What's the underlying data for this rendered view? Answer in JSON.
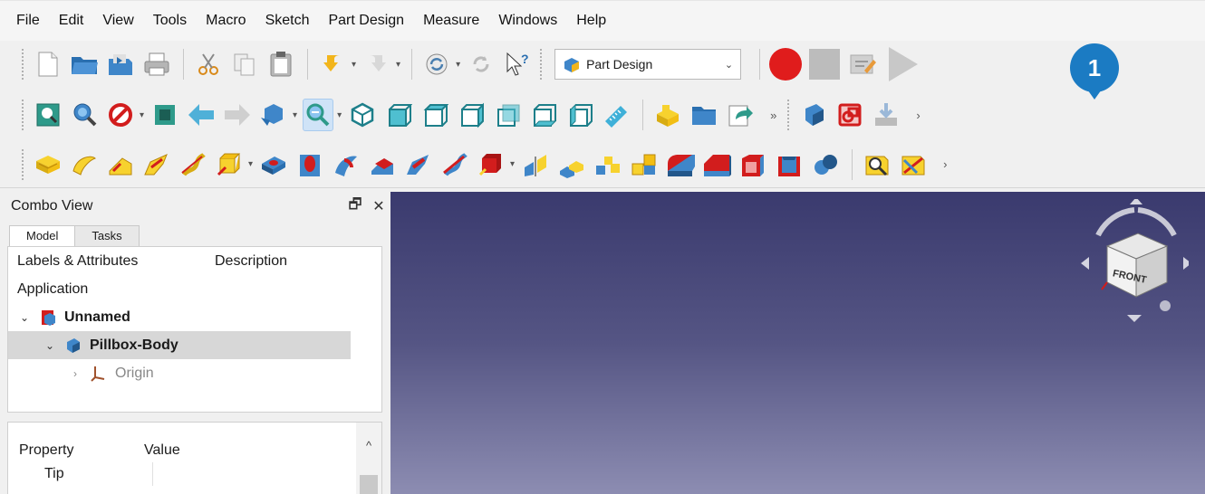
{
  "menu": [
    "File",
    "Edit",
    "View",
    "Tools",
    "Macro",
    "Sketch",
    "Part Design",
    "Measure",
    "Windows",
    "Help"
  ],
  "workbench": {
    "label": "Part Design",
    "icon": "part-design-icon"
  },
  "toolbar_icons": {
    "file": [
      "new-document-icon",
      "open-folder-icon",
      "save-icon",
      "print-icon",
      "cut-icon",
      "copy-icon",
      "paste-icon",
      "undo-icon",
      "redo-icon",
      "refresh-icon",
      "whats-this-icon"
    ],
    "macro": [
      "record-macro-icon",
      "stop-macro-icon",
      "edit-macro-icon",
      "run-macro-icon"
    ],
    "view": [
      "fit-all-icon",
      "fit-selection-icon",
      "draw-style-icon",
      "bounding-box-icon",
      "back-icon",
      "forward-icon",
      "std-views-icon",
      "zoom-icon",
      "isometric-icon",
      "front-view-icon",
      "top-view-icon",
      "right-view-icon",
      "rear-view-icon",
      "bottom-view-icon",
      "left-view-icon",
      "measure-distance-icon",
      "part-icon",
      "group-icon",
      "link-icon",
      "body-icon",
      "create-sketch-icon",
      "import-icon"
    ],
    "part_design": [
      "pad-icon",
      "revolution-icon",
      "additive-loft-icon",
      "additive-pipe-icon",
      "additive-helix-icon",
      "additive-box-icon",
      "pocket-icon",
      "hole-icon",
      "groove-icon",
      "subtractive-loft-icon",
      "subtractive-pipe-icon",
      "subtractive-helix-icon",
      "subtractive-box-icon",
      "mirrored-icon",
      "linear-pattern-icon",
      "polar-pattern-icon",
      "multitransform-icon",
      "fillet-icon",
      "chamfer-icon",
      "draft-icon",
      "thickness-icon",
      "boolean-icon",
      "measure-linear-icon",
      "measure-angular-icon"
    ]
  },
  "callout": {
    "number": "1",
    "color": "#1b7bc3"
  },
  "combo": {
    "title": "Combo View",
    "float_btn": "🗗",
    "close_btn": "✕",
    "tabs": [
      "Model",
      "Tasks"
    ],
    "tree_header": {
      "col1": "Labels & Attributes",
      "col2": "Description"
    },
    "application_label": "Application",
    "tree": [
      {
        "label": "Unnamed",
        "expander": "⌄",
        "icon": "document-icon"
      },
      {
        "label": "Pillbox-Body",
        "expander": "⌄",
        "icon": "body-icon"
      },
      {
        "label": "Origin",
        "expander": "›",
        "icon": "origin-icon"
      }
    ],
    "property_header": {
      "col1": "Property",
      "col2": "Value"
    },
    "property_rows": [
      {
        "name": "Tip",
        "value": ""
      }
    ]
  },
  "viewport": {
    "navcube_face": "FRONT",
    "bg_top": "#3a3a6e",
    "bg_bottom": "#8d8db2"
  }
}
